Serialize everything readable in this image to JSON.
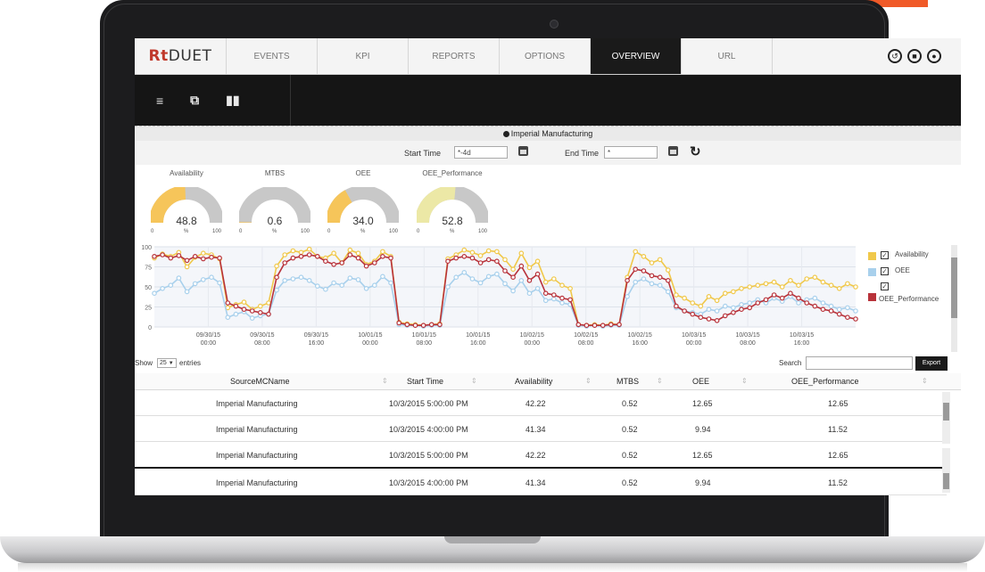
{
  "app": {
    "brand_prefix": "Rt",
    "brand_suffix": "DUET",
    "tabs": [
      "EVENTS",
      "KPI",
      "REPORTS",
      "OPTIONS",
      "OVERVIEW",
      "URL"
    ],
    "active_tab": "OVERVIEW"
  },
  "toolbar_icons": [
    "list-icon",
    "filter-icon",
    "bar-chart-icon"
  ],
  "header_icons": [
    "history-icon",
    "lock-icon",
    "record-icon"
  ],
  "title": "Imperial Manufacturing",
  "time_filter": {
    "start_label": "Start Time",
    "start_value": "*-4d",
    "end_label": "End Time",
    "end_value": "*"
  },
  "gauges": [
    {
      "title": "Availability",
      "value": "48.8",
      "min": "0",
      "unit": "%",
      "max": "100",
      "fraction": 0.488,
      "color": "#f6c55a"
    },
    {
      "title": "MTBS",
      "value": "0.6",
      "min": "0",
      "unit": "%",
      "max": "100",
      "fraction": 0.006,
      "color": "#f6c55a"
    },
    {
      "title": "OEE",
      "value": "34.0",
      "min": "0",
      "unit": "%",
      "max": "100",
      "fraction": 0.34,
      "color": "#f6c55a"
    },
    {
      "title": "OEE_Performance",
      "value": "52.8",
      "min": "0",
      "unit": "%",
      "max": "100",
      "fraction": 0.528,
      "color": "#ece8a6"
    }
  ],
  "chart_data": {
    "type": "line",
    "y_ticks": [
      "100",
      "75",
      "50",
      "25",
      "0"
    ],
    "ylim": [
      0,
      100
    ],
    "grid": true,
    "legend_position": "right",
    "x_ticks": [
      {
        "date": "09/30/15",
        "time": "00:00"
      },
      {
        "date": "09/30/15",
        "time": "08:00"
      },
      {
        "date": "09/30/15",
        "time": "16:00"
      },
      {
        "date": "10/01/15",
        "time": "00:00"
      },
      {
        "date": "10/01/15",
        "time": "08:00"
      },
      {
        "date": "10/01/15",
        "time": "16:00"
      },
      {
        "date": "10/02/15",
        "time": "00:00"
      },
      {
        "date": "10/02/15",
        "time": "08:00"
      },
      {
        "date": "10/02/15",
        "time": "16:00"
      },
      {
        "date": "10/03/15",
        "time": "00:00"
      },
      {
        "date": "10/03/15",
        "time": "08:00"
      },
      {
        "date": "10/03/15",
        "time": "16:00"
      }
    ],
    "series": [
      {
        "name": "Availability",
        "color": "#f0c84a",
        "values": [
          86,
          91,
          88,
          93,
          75,
          87,
          92,
          90,
          85,
          24,
          28,
          31,
          22,
          26,
          30,
          76,
          90,
          95,
          93,
          97,
          88,
          86,
          92,
          80,
          96,
          92,
          78,
          82,
          94,
          88,
          6,
          4,
          3,
          2,
          3,
          4,
          85,
          90,
          96,
          93,
          89,
          95,
          94,
          84,
          72,
          92,
          74,
          82,
          56,
          60,
          52,
          48,
          3,
          2,
          3,
          2,
          4,
          3,
          62,
          94,
          88,
          80,
          84,
          71,
          40,
          36,
          30,
          26,
          38,
          33,
          42,
          44,
          48,
          50,
          52,
          54,
          56,
          50,
          58,
          52,
          60,
          62,
          56,
          52,
          48,
          54,
          50
        ]
      },
      {
        "name": "OEE",
        "color": "#a8d0ec",
        "values": [
          42,
          48,
          52,
          61,
          44,
          54,
          59,
          62,
          55,
          12,
          16,
          19,
          11,
          14,
          16,
          46,
          58,
          60,
          62,
          58,
          51,
          47,
          55,
          52,
          61,
          59,
          48,
          52,
          63,
          55,
          3,
          2,
          2,
          1,
          2,
          2,
          50,
          62,
          68,
          60,
          55,
          63,
          66,
          54,
          45,
          58,
          42,
          48,
          33,
          35,
          30,
          28,
          2,
          1,
          2,
          1,
          2,
          2,
          38,
          56,
          60,
          54,
          52,
          44,
          24,
          20,
          18,
          16,
          22,
          20,
          26,
          24,
          28,
          30,
          34,
          30,
          36,
          32,
          38,
          30,
          34,
          36,
          30,
          26,
          22,
          24,
          20
        ]
      },
      {
        "name": "OEE_Performance",
        "color": "#b8323a",
        "values": [
          88,
          90,
          86,
          89,
          83,
          88,
          85,
          87,
          86,
          30,
          26,
          22,
          20,
          18,
          16,
          62,
          80,
          86,
          88,
          90,
          88,
          82,
          78,
          80,
          90,
          86,
          76,
          80,
          88,
          86,
          5,
          3,
          2,
          2,
          3,
          3,
          82,
          86,
          88,
          86,
          80,
          84,
          82,
          70,
          62,
          76,
          58,
          66,
          42,
          40,
          36,
          34,
          3,
          2,
          2,
          2,
          3,
          3,
          58,
          72,
          70,
          64,
          62,
          58,
          26,
          20,
          16,
          12,
          10,
          8,
          14,
          18,
          22,
          24,
          30,
          34,
          40,
          36,
          42,
          36,
          30,
          26,
          22,
          20,
          16,
          12,
          10
        ]
      }
    ]
  },
  "legend": [
    {
      "label": "Availability",
      "color": "#f0c84a"
    },
    {
      "label": "OEE",
      "color": "#a8d0ec"
    },
    {
      "label": "OEE_Performance",
      "color": "#b8323a"
    }
  ],
  "table_tools": {
    "show_label": "Show",
    "show_value": "25",
    "entries_label": "entries",
    "search_label": "Search",
    "export_label": "Export"
  },
  "table": {
    "columns": [
      "SourceMCName",
      "Start Time",
      "Availability",
      "MTBS",
      "OEE",
      "OEE_Performance"
    ],
    "rows": [
      [
        "Imperial Manufacturing",
        "10/3/2015 5:00:00 PM",
        "42.22",
        "0.52",
        "12.65",
        "12.65"
      ],
      [
        "Imperial Manufacturing",
        "10/3/2015 4:00:00 PM",
        "41.34",
        "0.52",
        "9.94",
        "11.52"
      ],
      [
        "Imperial Manufacturing",
        "10/3/2015 5:00:00 PM",
        "42.22",
        "0.52",
        "12.65",
        "12.65"
      ],
      [
        "Imperial Manufacturing",
        "10/3/2015 4:00:00 PM",
        "41.34",
        "0.52",
        "9.94",
        "11.52"
      ]
    ]
  }
}
